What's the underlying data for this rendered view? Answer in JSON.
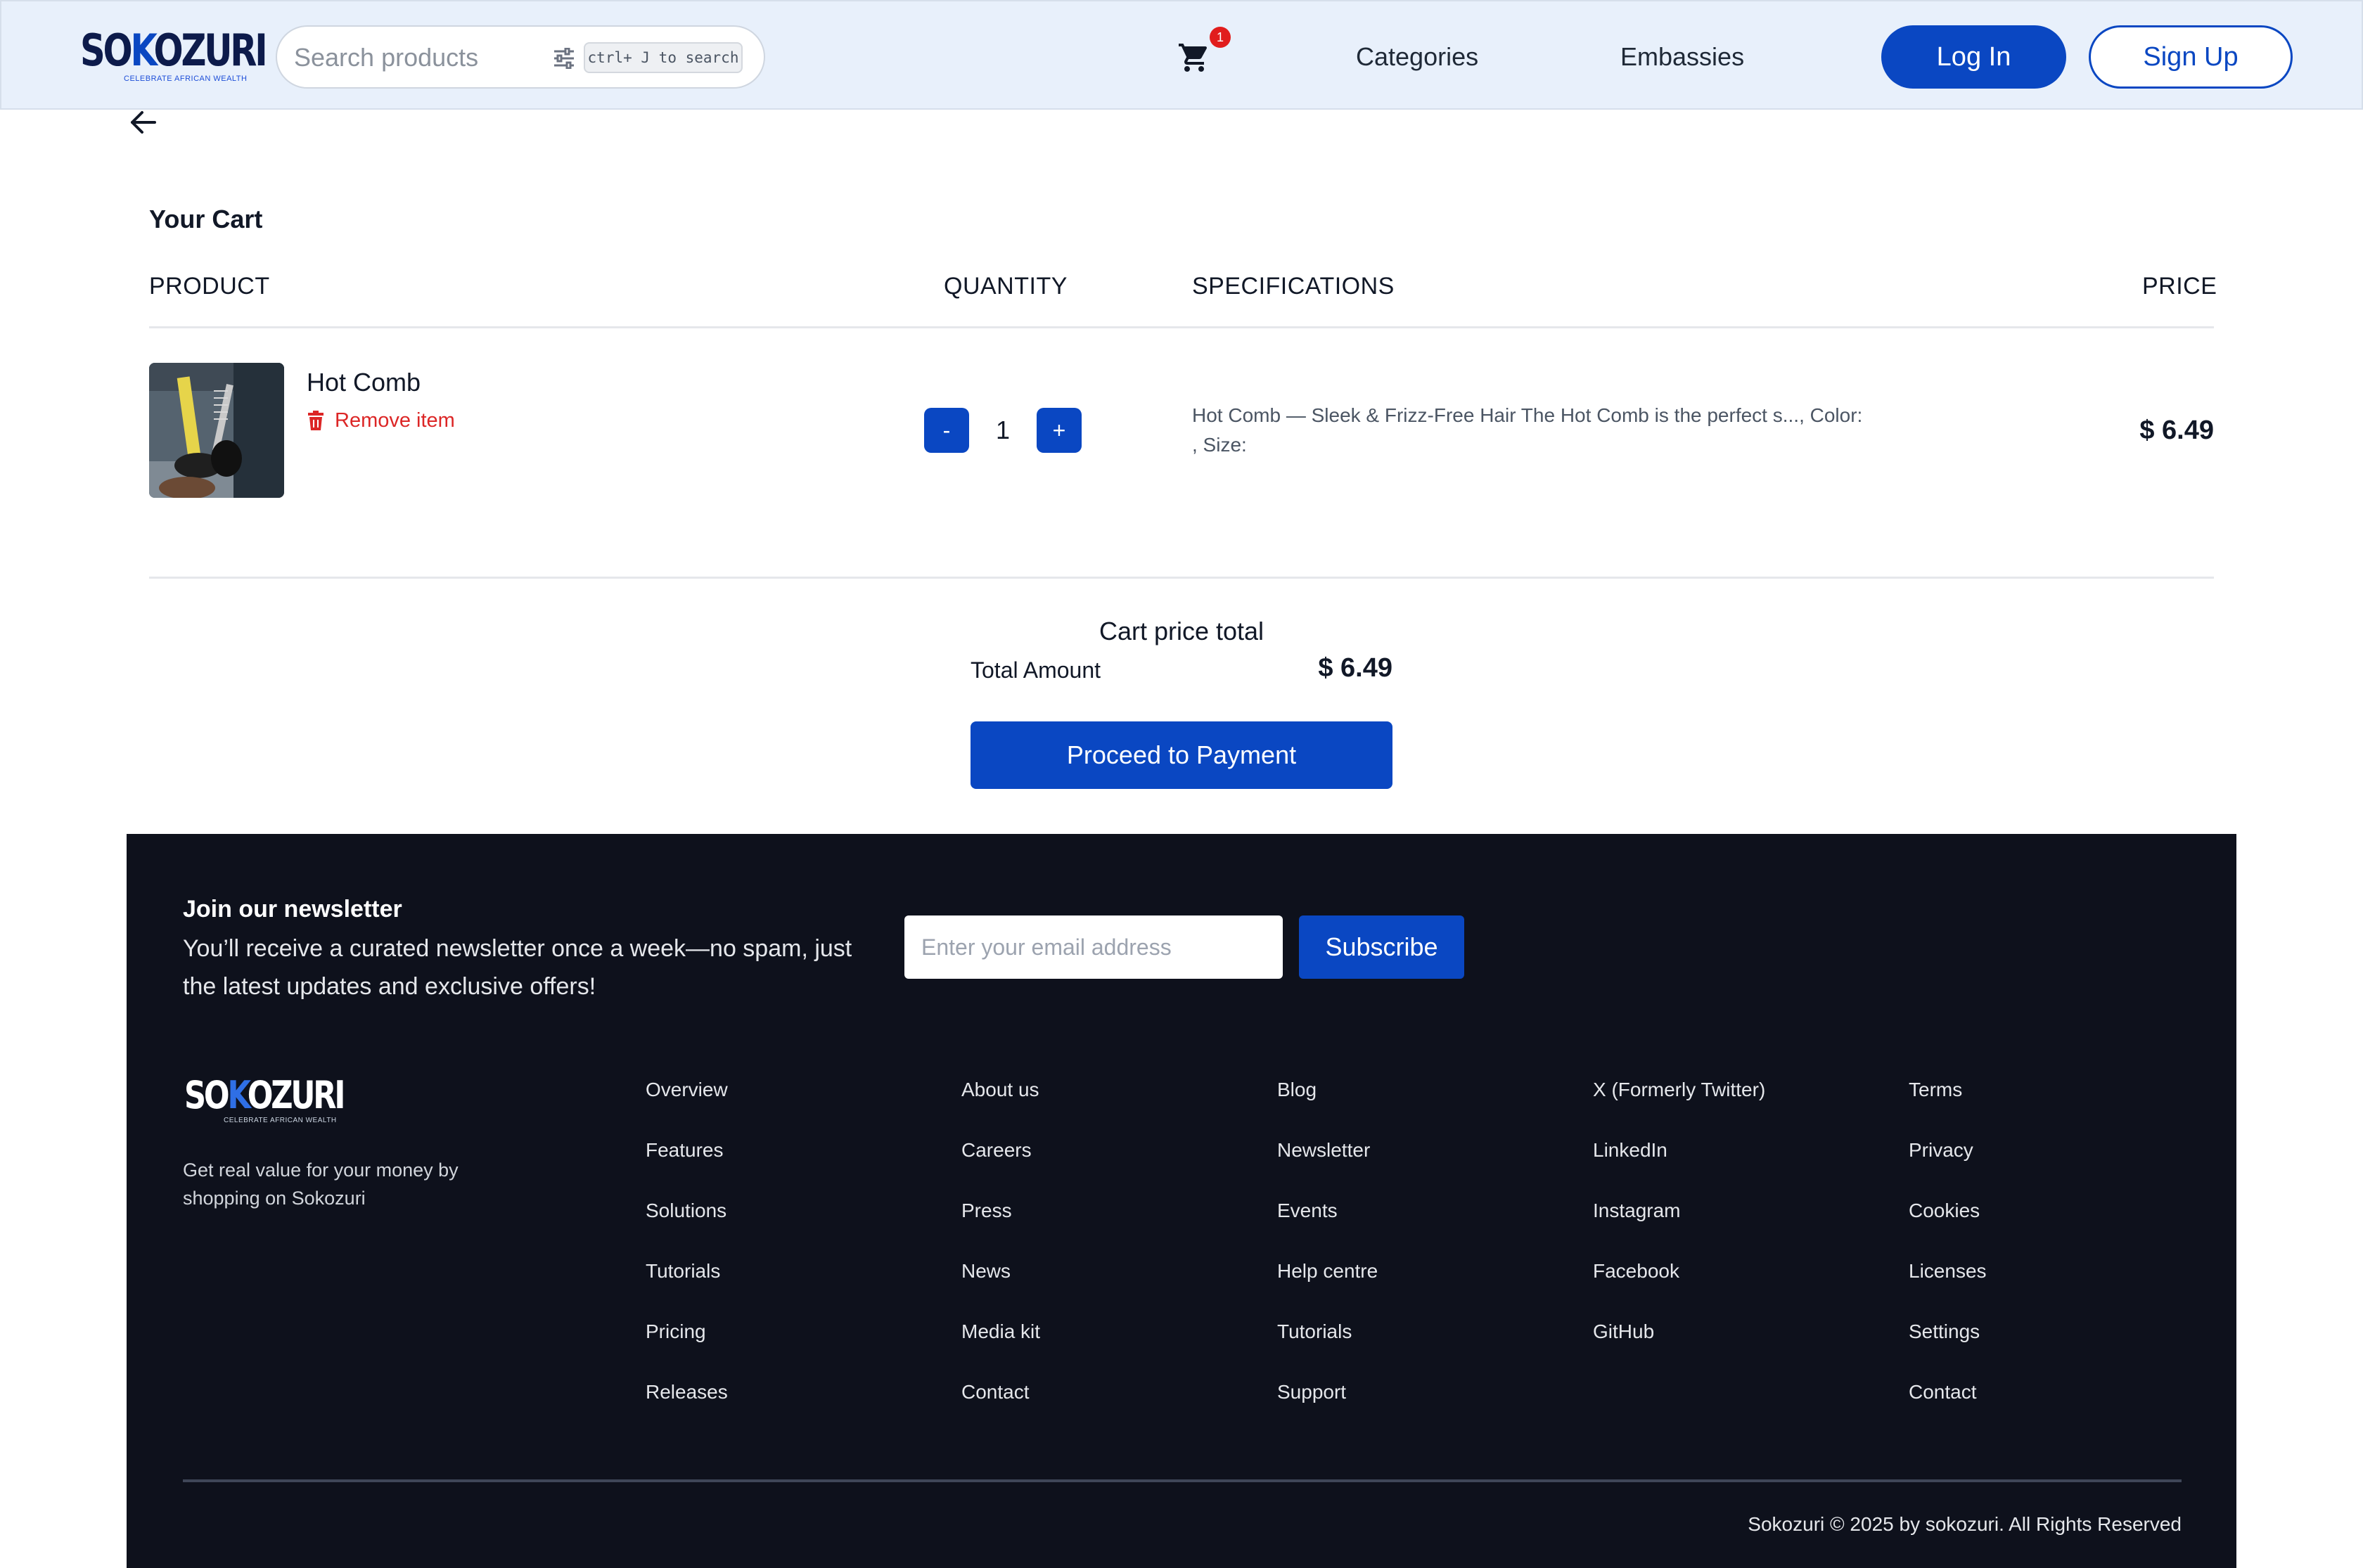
{
  "header": {
    "logo": {
      "word": "SOKOZURI",
      "tagline": "CELEBRATE AFRICAN WEALTH"
    },
    "search": {
      "placeholder": "Search products",
      "shortcut": "ctrl+ J to search",
      "filter_icon": "sliders-icon"
    },
    "cart": {
      "icon": "cart-icon",
      "badge_count": "1"
    },
    "nav": {
      "categories": "Categories",
      "embassies": "Embassies"
    },
    "login_label": "Log In",
    "signup_label": "Sign Up",
    "colors": {
      "background": "#e8f0fb",
      "accent": "#0a47c2"
    }
  },
  "cart": {
    "back_icon": "arrow-left-icon",
    "title": "Your Cart",
    "columns": {
      "product": "PRODUCT",
      "quantity": "QUANTITY",
      "specifications": "SPECIFICATIONS",
      "price": "PRICE"
    },
    "items": [
      {
        "name": "Hot Comb",
        "remove_label": "Remove item",
        "remove_icon": "trash-icon",
        "quantity": "1",
        "minus_label": "-",
        "plus_label": "+",
        "specifications": "Hot Comb — Sleek & Frizz-Free Hair The Hot Comb is the perfect s..., Color: , Size:",
        "price": "$ 6.49"
      }
    ],
    "summary": {
      "title": "Cart price total",
      "total_label": "Total Amount",
      "total_value": "$ 6.49",
      "proceed_label": "Proceed to Payment"
    }
  },
  "footer": {
    "newsletter": {
      "title": "Join our newsletter",
      "description": "You’ll receive a curated newsletter once a week—no spam, just the latest updates and exclusive offers!",
      "email_placeholder": "Enter your email address",
      "subscribe_label": "Subscribe"
    },
    "logo": {
      "word": "SOKOZURI",
      "tagline": "CELEBRATE AFRICAN WEALTH"
    },
    "tagline": "Get real value for your money by shopping on Sokozuri",
    "columns": [
      [
        "Overview",
        "Features",
        "Solutions",
        "Tutorials",
        "Pricing",
        "Releases"
      ],
      [
        "About us",
        "Careers",
        "Press",
        "News",
        "Media kit",
        "Contact"
      ],
      [
        "Blog",
        "Newsletter",
        "Events",
        "Help centre",
        "Tutorials",
        "Support"
      ],
      [
        "X (Formerly Twitter)",
        "LinkedIn",
        "Instagram",
        "Facebook",
        "GitHub"
      ],
      [
        "Terms",
        "Privacy",
        "Cookies",
        "Licenses",
        "Settings",
        "Contact"
      ]
    ],
    "copyright": "Sokozuri © 2025 by sokozuri. All Rights Reserved",
    "colors": {
      "background": "#0e111c"
    }
  }
}
